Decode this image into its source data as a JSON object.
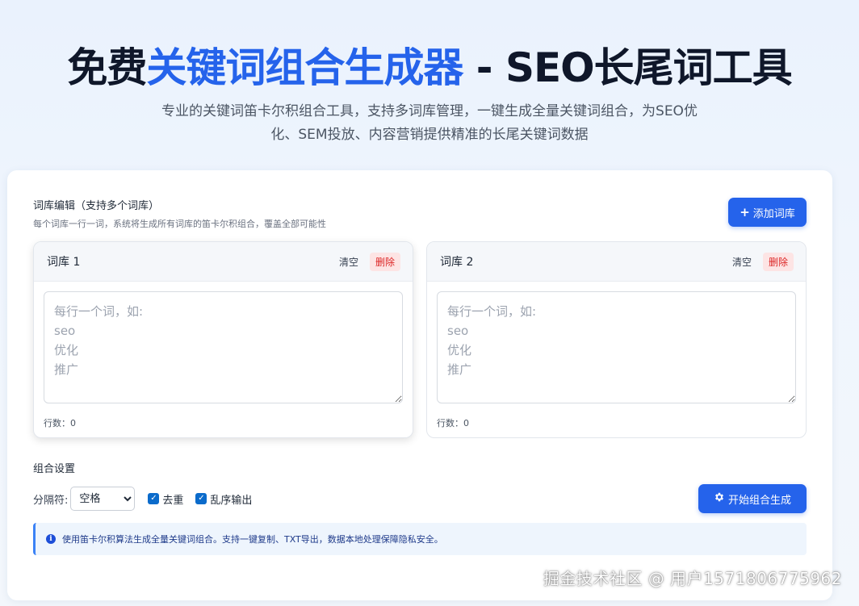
{
  "hero": {
    "title_part1": "免费",
    "title_accent": "关键词组合生成器",
    "title_part2": " - SEO长尾词工具",
    "subtitle": "专业的关键词笛卡尔积组合工具，支持多词库管理，一键生成全量关键词组合，为SEO优化、SEM投放、内容营销提供精准的长尾关键词数据"
  },
  "editor": {
    "title": "词库编辑（支持多个词库）",
    "description": "每个词库一行一词，系统将生成所有词库的笛卡尔积组合，覆盖全部可能性",
    "add_button_icon": "+",
    "add_button_label": "添加词库"
  },
  "libraries": [
    {
      "name": "词库 1",
      "clear_label": "清空",
      "delete_label": "删除",
      "value": "",
      "placeholder": "每行一个词，如:\nseo\n优化\n推广",
      "line_count_label": "行数：",
      "line_count": "0"
    },
    {
      "name": "词库 2",
      "clear_label": "清空",
      "delete_label": "删除",
      "value": "",
      "placeholder": "每行一个词，如:\nseo\n优化\n推广",
      "line_count_label": "行数：",
      "line_count": "0"
    }
  ],
  "settings": {
    "title": "组合设置",
    "separator_label": "分隔符:",
    "separator_selected": "空格",
    "dedupe": {
      "label": "去重",
      "checked": true
    },
    "shuffle": {
      "label": "乱序输出",
      "checked": true
    },
    "generate_icon": "gear-icon",
    "generate_label": "开始组合生成"
  },
  "info": {
    "icon": "info-icon",
    "text": "使用笛卡尔积算法生成全量关键词组合。支持一键复制、TXT导出，数据本地处理保障隐私安全。"
  },
  "watermark": "掘金技术社区 @ 用户1571806775962",
  "colors": {
    "accent": "#2563eb",
    "danger": "#dc2626",
    "danger_bg": "#fde4e4",
    "checkbox": "#0b6bcb",
    "info_border": "#3b82f6"
  }
}
